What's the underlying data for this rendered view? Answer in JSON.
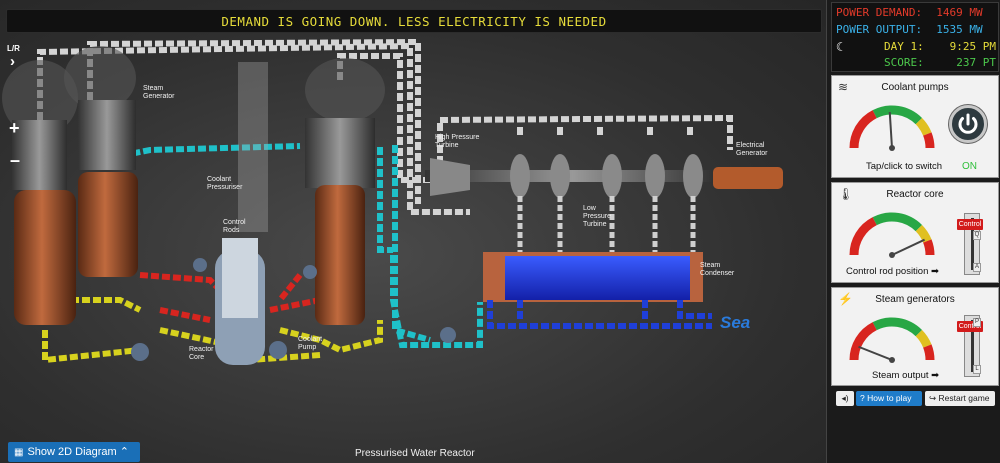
{
  "ticker": {
    "message": "DEMAND IS GOING DOWN. LESS ELECTRICITY IS NEEDED"
  },
  "controls": {
    "lr": "L/R",
    "lr_arrow": "›",
    "zoom_in": "+",
    "zoom_out": "–"
  },
  "footer": {
    "show_2d": "Show 2D Diagram",
    "caption": "Pressurised Water Reactor"
  },
  "labels": {
    "steam_generator": [
      "Steam",
      "Generator"
    ],
    "coolant_pressuriser": [
      "Coolant",
      "Pressuriser"
    ],
    "control_rods": [
      "Control",
      "Rods"
    ],
    "reactor_core": [
      "Reactor",
      "Core"
    ],
    "coolant_pump": [
      "Coolant",
      "Pump"
    ],
    "hp_turbine": [
      "High Pressure",
      "Turbine"
    ],
    "lp_turbine": [
      "Low",
      "Pressure",
      "Turbine"
    ],
    "electrical_generator": [
      "Electrical",
      "Generator"
    ],
    "steam_condenser": [
      "Steam",
      "Condenser"
    ],
    "sea": "Sea"
  },
  "status": {
    "demand_label": "POWER DEMAND:",
    "demand_value": "1469",
    "demand_unit": "MW",
    "output_label": "POWER OUTPUT:",
    "output_value": "1535",
    "output_unit": "MW",
    "day_label": "DAY 1:",
    "time": "9:25 PM",
    "score_label": "SCORE:",
    "score_value": "237",
    "score_unit": "PT"
  },
  "coolant": {
    "title": "Coolant pumps",
    "hint": "Tap/click to switch",
    "state": "ON",
    "gauge_level": 0.48
  },
  "core": {
    "title": "Reactor core",
    "control": "Control rod position ➡",
    "gauge_level": 0.86,
    "slider_tag": "Control",
    "slider_top": "Q",
    "slider_bottom": "A"
  },
  "steam": {
    "title": "Steam generators",
    "control": "Steam output ➡",
    "gauge_level": 0.12,
    "slider_tag": "Control",
    "slider_top": "P",
    "slider_bottom": "L"
  },
  "buttons": {
    "sound": "◂)",
    "howto": "How to play",
    "restart": "Restart game"
  },
  "colors": {
    "hot": "#d8251f",
    "cold": "#d7d21e",
    "water": "#1fc1c9",
    "steam": "#d9d9d9",
    "sea": "#1e44d8"
  }
}
